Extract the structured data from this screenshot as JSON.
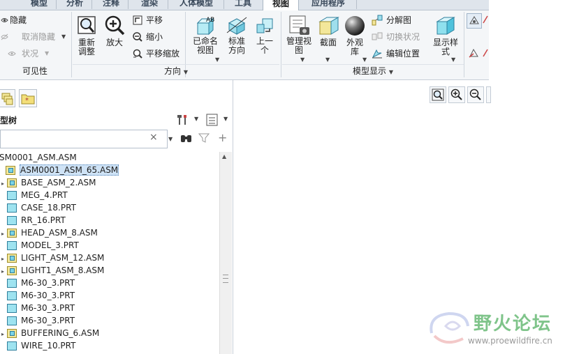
{
  "tabs": [
    {
      "label": "模型",
      "active": false
    },
    {
      "label": "分析",
      "active": false
    },
    {
      "label": "注释",
      "active": false
    },
    {
      "label": "渲染",
      "active": false
    },
    {
      "label": "人体模型",
      "active": false
    },
    {
      "label": "工具",
      "active": false
    },
    {
      "label": "视图",
      "active": true
    },
    {
      "label": "应用程序",
      "active": false
    }
  ],
  "visibility_group": {
    "hide": "隐藏",
    "unhide": "取消隐藏",
    "status": "状况",
    "label": "可见性"
  },
  "orientation_group": {
    "refit": "重新\n调整",
    "zoom_in": "放大",
    "pan": "平移",
    "zoom_out": "缩小",
    "pan_zoom": "平移缩放",
    "named_views": "已命名\n视图",
    "standard_orientation": "标准\n方向",
    "previous": "上一\n个",
    "label": "方向"
  },
  "display_group": {
    "manage_views": "管理视\n图",
    "section": "截面",
    "appearance": "外观\n库",
    "exploded_view": "分解图",
    "toggle_status": "切换状况",
    "edit_position": "编辑位置",
    "display_style": "显示样\n式",
    "label": "模型显示"
  },
  "model_tree": {
    "title": "型树",
    "search_placeholder": "",
    "root": "SM0001_ASM.ASM",
    "items": [
      {
        "label": "ASM0001_ASM_65.ASM",
        "type": "asm",
        "selected": true,
        "expandable": false
      },
      {
        "label": "BASE_ASM_2.ASM",
        "type": "asm",
        "expandable": true
      },
      {
        "label": "MEG_4.PRT",
        "type": "prt",
        "expandable": false
      },
      {
        "label": "CASE_18.PRT",
        "type": "prt",
        "expandable": false
      },
      {
        "label": "RR_16.PRT",
        "type": "prt",
        "expandable": false
      },
      {
        "label": "HEAD_ASM_8.ASM",
        "type": "asm",
        "expandable": true
      },
      {
        "label": "MODEL_3.PRT",
        "type": "prt",
        "expandable": false
      },
      {
        "label": "LIGHT_ASM_12.ASM",
        "type": "asm",
        "expandable": true
      },
      {
        "label": "LIGHT1_ASM_8.ASM",
        "type": "asm",
        "expandable": true
      },
      {
        "label": "M6-30_3.PRT",
        "type": "prt",
        "expandable": false
      },
      {
        "label": "M6-30_3.PRT",
        "type": "prt",
        "expandable": false
      },
      {
        "label": "M6-30_3.PRT",
        "type": "prt",
        "expandable": false
      },
      {
        "label": "M6-30_3.PRT",
        "type": "prt",
        "expandable": false
      },
      {
        "label": "BUFFERING_6.ASM",
        "type": "asm",
        "expandable": true
      },
      {
        "label": "WIRE_10.PRT",
        "type": "prt",
        "expandable": false
      }
    ]
  },
  "watermark": {
    "text": "野火论坛",
    "url": "www.proewildfire.cn"
  },
  "colors": {
    "tab_bar": "#dfe5ec",
    "ribbon": "#f4f6f8",
    "selection": "#cfe3f6",
    "part_icon": "#9ee3f0",
    "assembly_icon": "#f3e79a",
    "watermark_green": "#7fc48a"
  }
}
